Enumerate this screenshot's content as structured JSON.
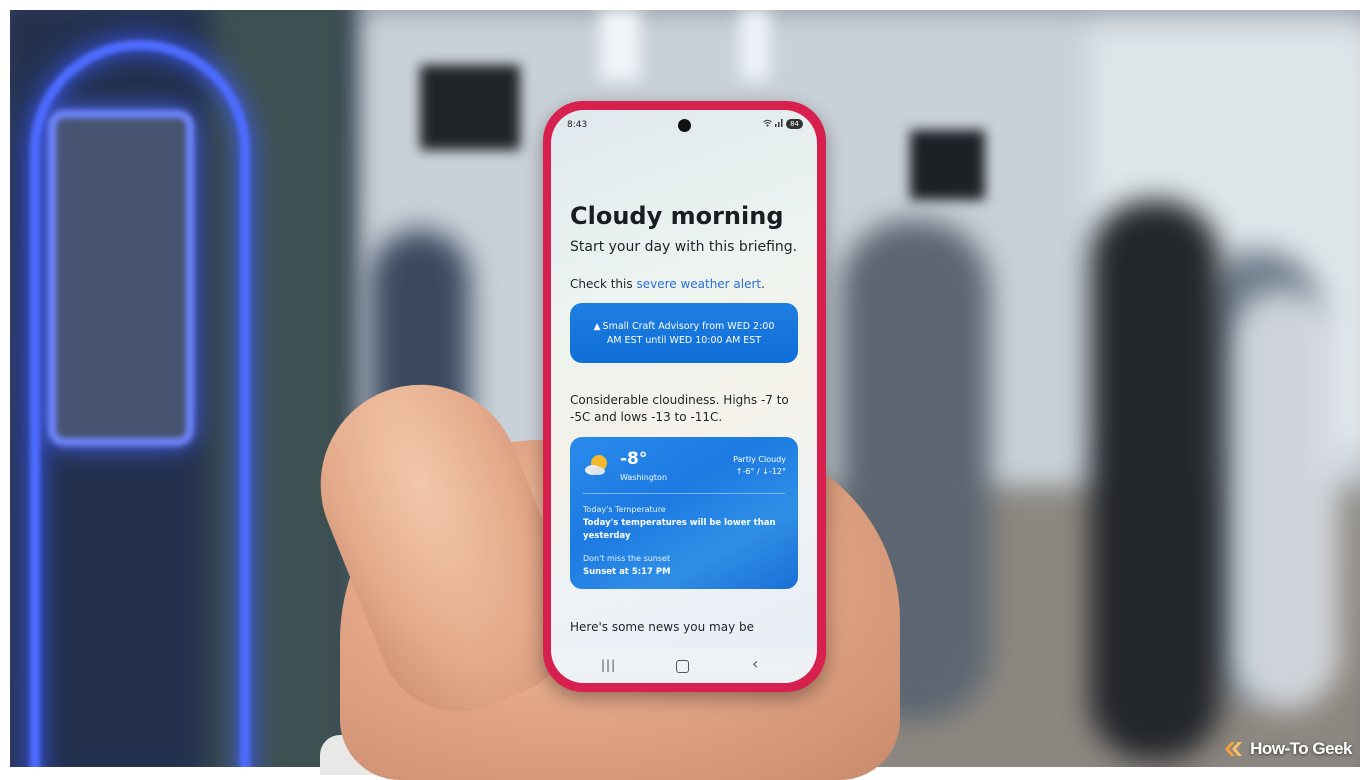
{
  "status_bar": {
    "time": "8:43",
    "battery": "84"
  },
  "briefing": {
    "title": "Cloudy morning",
    "subtitle": "Start your day with this briefing.",
    "alert_prefix": "Check this ",
    "alert_link": "severe weather alert",
    "alert_suffix": "."
  },
  "advisory": {
    "text": "Small Craft Advisory from WED 2:00 AM EST until WED 10:00 AM EST"
  },
  "forecast": "Considerable cloudiness. Highs -7 to -5C and lows -13 to -11C.",
  "weather_card": {
    "temperature": "-8°",
    "city": "Washington",
    "condition": "Partly Cloudy",
    "high_low": "↑-6° / ↓-12°",
    "temp_label": "Today's Temperature",
    "temp_text": "Today's temperatures will be lower than yesterday",
    "sunset_label": "Don't miss the sunset",
    "sunset_text": "Sunset at 5:17 PM"
  },
  "news_text": "Here's some news you may be",
  "nav": {
    "recents": "|||",
    "back": "‹"
  },
  "watermark": "How-To Geek",
  "colors": {
    "phone_frame": "#d8204e",
    "card_blue": "#1c7ae2",
    "link_blue": "#2c6fd3",
    "neon_blue": "#4d6bff"
  }
}
